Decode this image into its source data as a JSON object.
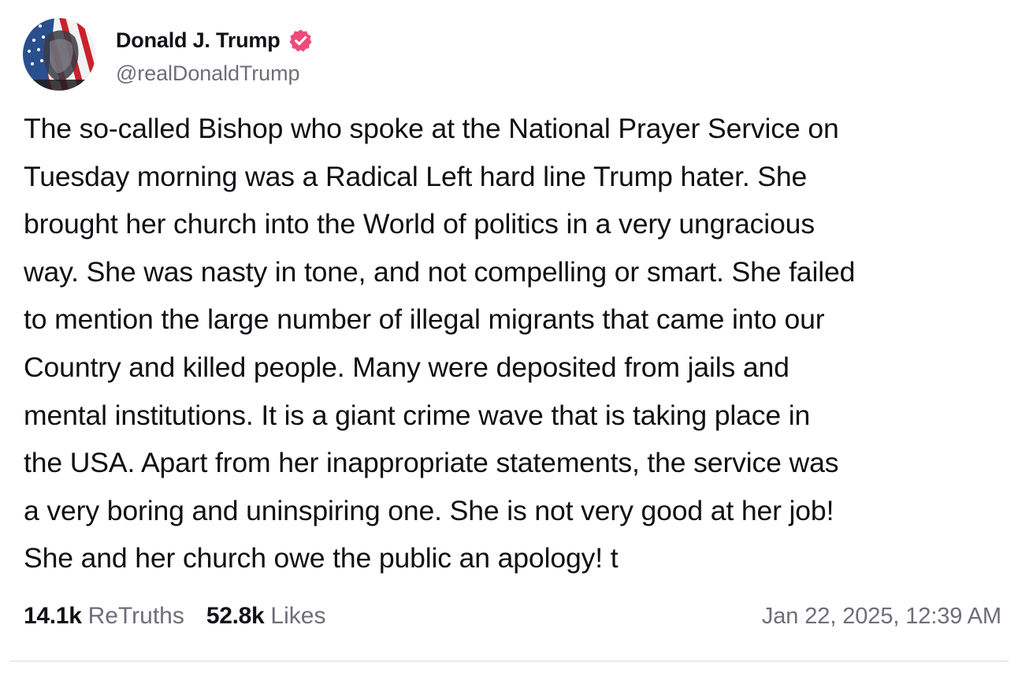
{
  "post": {
    "author": {
      "display_name": "Donald J. Trump",
      "handle": "@realDonaldTrump",
      "verified_icon": "verified-badge-icon",
      "verified_color": "#ee4b7a"
    },
    "body": "The so-called Bishop who spoke at the National Prayer Service on\nTuesday morning was a Radical Left hard line Trump hater. She\nbrought her church into the World of politics in a very ungracious\nway. She was nasty in tone, and not compelling or smart. She failed\nto mention the large number of illegal migrants that came into our\nCountry and killed people. Many were deposited from jails and\nmental institutions. It is a giant crime wave that is taking place in\nthe USA. Apart from her inappropriate statements, the service was\na very boring and uninspiring one. She is not very good at her job!\nShe and her church owe the public an apology! t",
    "stats": {
      "retruths_count": "14.1k",
      "retruths_label": "ReTruths",
      "likes_count": "52.8k",
      "likes_label": "Likes"
    },
    "timestamp": "Jan 22, 2025, 12:39 AM"
  },
  "colors": {
    "text": "#0f0f14",
    "muted": "#6e6e78",
    "accent": "#ee4b7a",
    "background": "#ffffff"
  }
}
